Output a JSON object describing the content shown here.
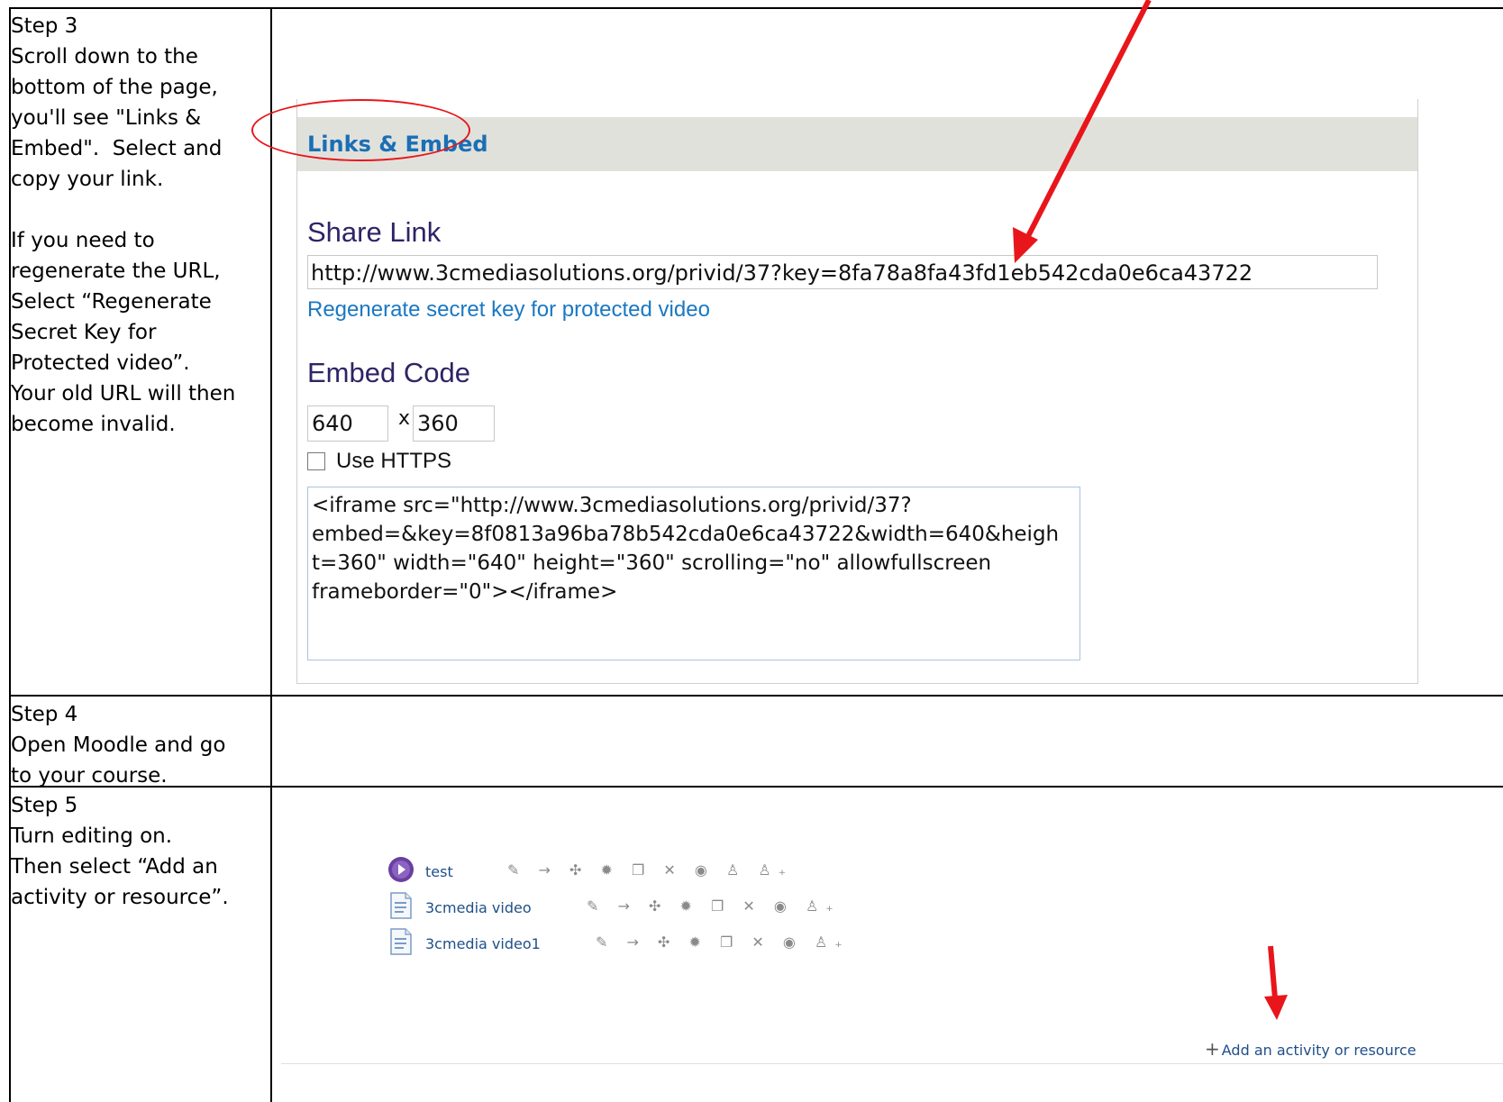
{
  "steps": [
    {
      "lines": [
        "Step 3",
        "Scroll down to the",
        "bottom of the page,",
        "you'll see \"Links &",
        "Embed\".  Select and",
        "copy your link.",
        "",
        "If you need to",
        "regenerate the URL,",
        "Select “Regenerate",
        "Secret Key for",
        "Protected video”.",
        "Your old URL will then",
        "become invalid."
      ]
    },
    {
      "lines": [
        "Step 4",
        "Open Moodle and go",
        "to your course."
      ]
    },
    {
      "lines": [
        "Step 5",
        "Turn editing on.",
        "Then select “Add an",
        "activity or resource”."
      ]
    }
  ],
  "links_embed": {
    "section_title": "Links & Embed",
    "share_heading": "Share Link",
    "share_url": "http://www.3cmediasolutions.org/privid/37?key=8fa78a8fa43fd1eb542cda0e6ca43722",
    "regenerate_link": "Regenerate secret key for protected video",
    "embed_heading": "Embed Code",
    "width": "640",
    "times_sign": "x",
    "height": "360",
    "https_label": "Use HTTPS",
    "https_checked": false,
    "embed_code_lines": [
      "<iframe src=\"http://www.3cmediasolutions.org/privid/37?",
      "embed=&key=8f0813a96ba78b542cda0e6ca43722&width=640&heigh",
      "t=360\" width=\"640\" height=\"360\" scrolling=\"no\" allowfullscreen",
      "frameborder=\"0\"></iframe>"
    ]
  },
  "moodle": {
    "items": [
      {
        "name": "test",
        "icon": "media-player-icon",
        "actions": "✎ → ✣ ✹ ❐ ✕ ◉ ♙ ♙₊"
      },
      {
        "name": "3cmedia video",
        "icon": "page-icon",
        "actions": "✎ → ✣ ✹ ❐ ✕ ◉ ♙₊"
      },
      {
        "name": "3cmedia video1",
        "icon": "page-icon",
        "actions": "✎ → ✣ ✹ ❐ ✕ ◉ ♙₊"
      }
    ],
    "add_link": "Add an activity or resource",
    "add_icon": "+"
  },
  "annotations": {
    "arrow_color": "#e8161b",
    "ellipse_color": "#e8161b"
  }
}
